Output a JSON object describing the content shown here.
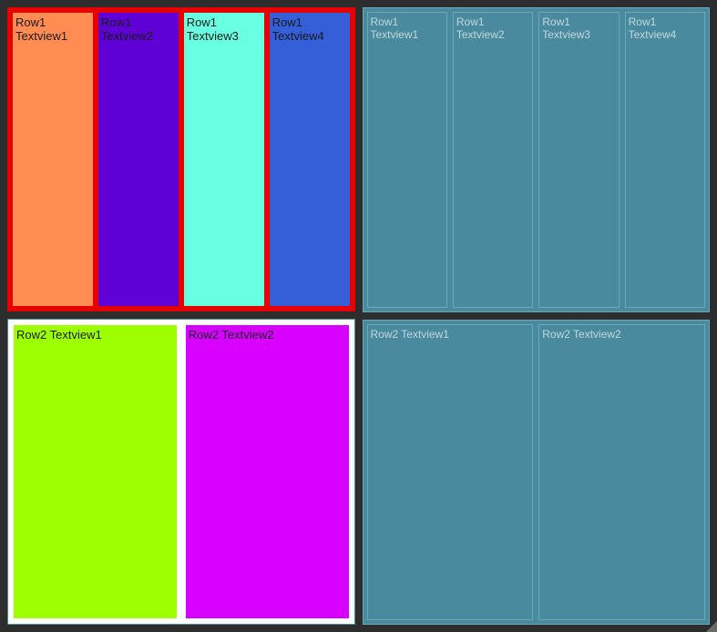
{
  "left": {
    "row1": {
      "cells": [
        {
          "label": "Row1 Textview1",
          "color": "orange"
        },
        {
          "label": "Row1 Textview2",
          "color": "purple"
        },
        {
          "label": "Row1 Textview3",
          "color": "cyan"
        },
        {
          "label": "Row1 Textview4",
          "color": "blue"
        }
      ]
    },
    "row2": {
      "cells": [
        {
          "label": "Row2 Textview1",
          "color": "lime"
        },
        {
          "label": "Row2 Textview2",
          "color": "magenta"
        }
      ]
    }
  },
  "right": {
    "row1": {
      "cells": [
        {
          "label": "Row1 Textview1"
        },
        {
          "label": "Row1 Textview2"
        },
        {
          "label": "Row1 Textview3"
        },
        {
          "label": "Row1 Textview4"
        }
      ]
    },
    "row2": {
      "cells": [
        {
          "label": "Row2 Textview1"
        },
        {
          "label": "Row2 Textview2"
        }
      ]
    }
  }
}
